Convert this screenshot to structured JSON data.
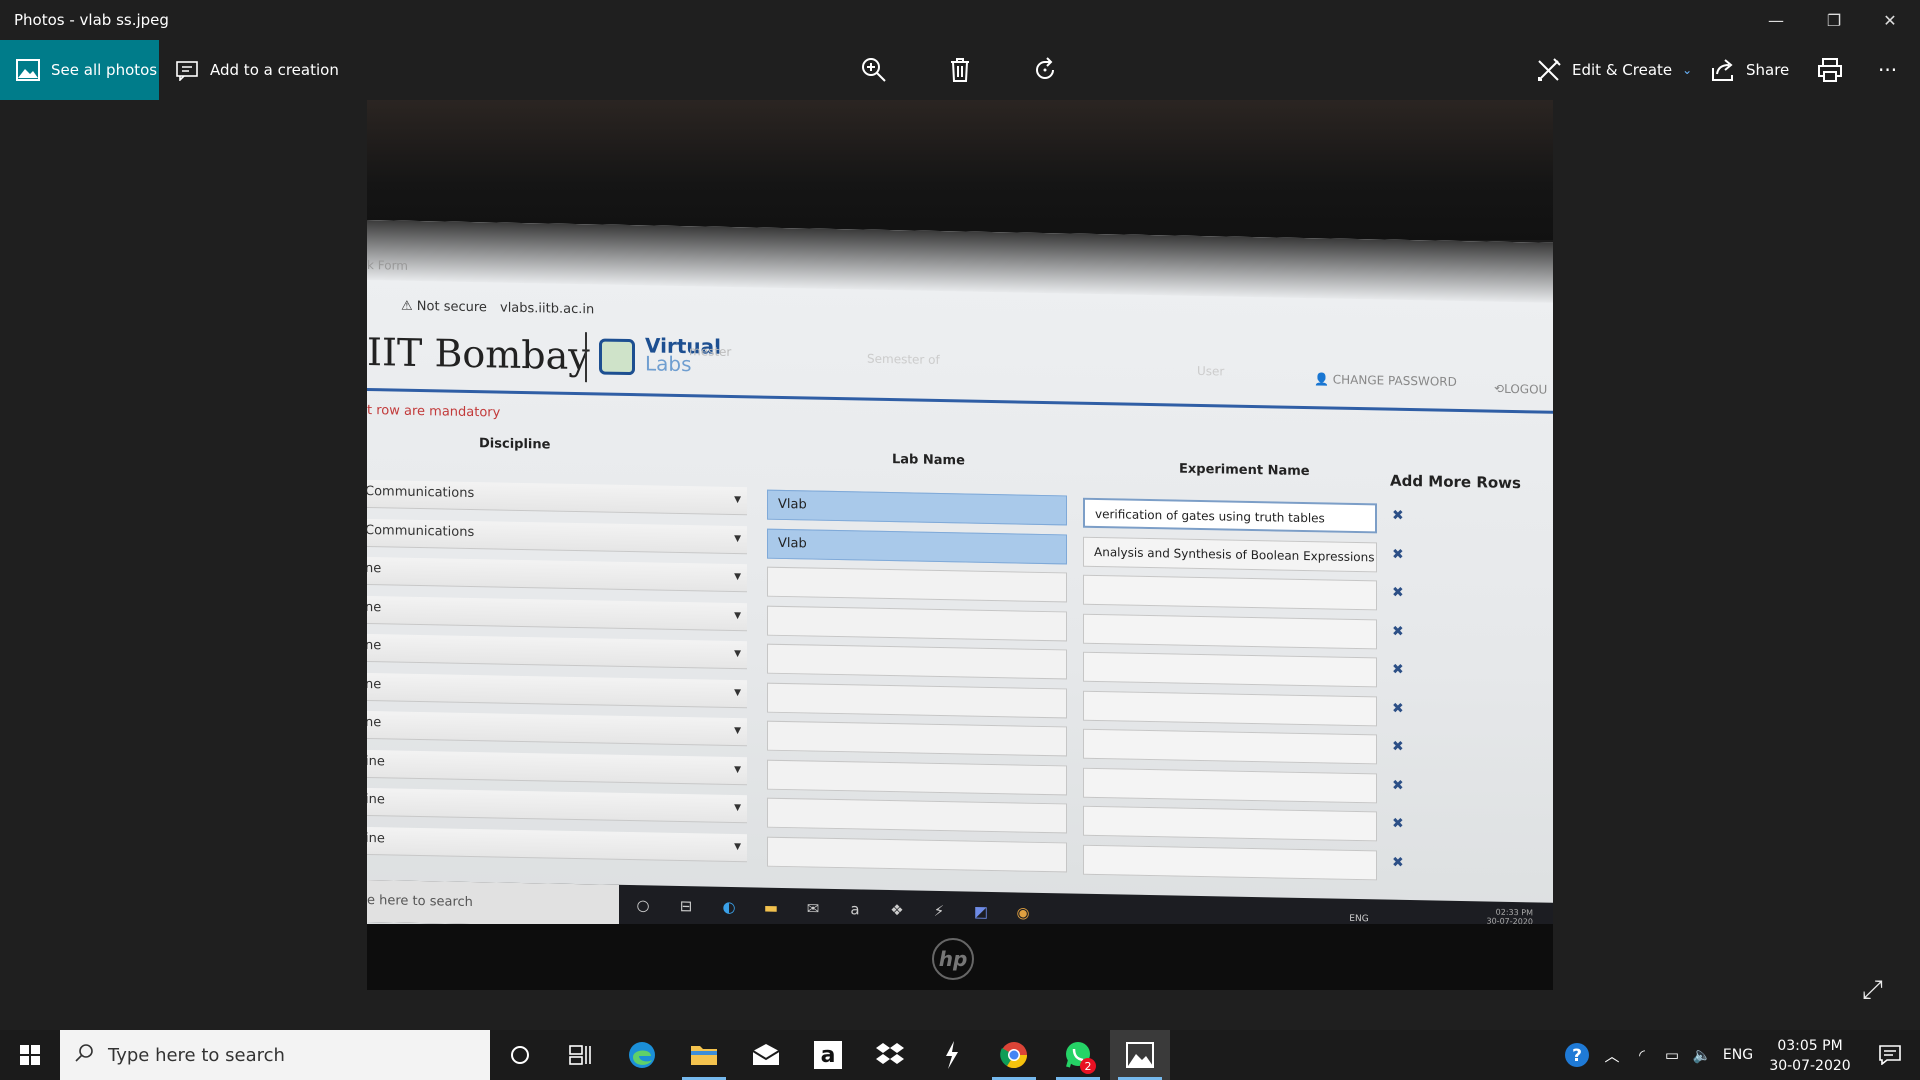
{
  "window": {
    "title": "Photos - vlab ss.jpeg",
    "minimize": "—",
    "maximize": "❐",
    "close": "✕"
  },
  "commandbar": {
    "see_all_photos": "See all photos",
    "add_to_creation": "Add to a creation",
    "edit_create": "Edit & Create",
    "share": "Share",
    "more": "···"
  },
  "photo": {
    "browser": {
      "tab_text": "k Form",
      "not_secure": "Not secure",
      "url": "vlabs.iitb.ac.in"
    },
    "site": {
      "brand": "IIT Bombay",
      "virtual": "Virtual",
      "labs": "Labs",
      "semester": "mester",
      "semester_of": "Semester of",
      "user": "User",
      "change_password": "CHANGE PASSWORD",
      "logout": "LOGOU"
    },
    "form": {
      "mandatory_note": "t row are mandatory",
      "headers": {
        "discipline": "Discipline",
        "lab_name": "Lab Name",
        "experiment_name": "Experiment Name",
        "add_more_rows": "Add More Rows"
      },
      "rows": [
        {
          "discipline": "Communications",
          "lab": "Vlab",
          "experiment": "verification of gates using truth tables"
        },
        {
          "discipline": "Communications",
          "lab": "Vlab",
          "experiment": "Analysis and Synthesis of Boolean Expressions us"
        },
        {
          "discipline": "ne",
          "lab": "",
          "experiment": ""
        },
        {
          "discipline": "ne",
          "lab": "",
          "experiment": ""
        },
        {
          "discipline": "ne",
          "lab": "",
          "experiment": ""
        },
        {
          "discipline": "ne",
          "lab": "",
          "experiment": ""
        },
        {
          "discipline": "ne",
          "lab": "",
          "experiment": ""
        },
        {
          "discipline": "ine",
          "lab": "",
          "experiment": ""
        },
        {
          "discipline": "ine",
          "lab": "",
          "experiment": ""
        },
        {
          "discipline": "ine",
          "lab": "",
          "experiment": ""
        }
      ]
    },
    "laptop_taskbar": {
      "search": "e here to search",
      "tray_text": "ENG",
      "time": "02:33 PM",
      "date": "30-07-2020"
    }
  },
  "taskbar": {
    "search_placeholder": "Type here to search",
    "language": "ENG",
    "time": "03:05 PM",
    "date": "30-07-2020",
    "whatsapp_badge": "2"
  }
}
